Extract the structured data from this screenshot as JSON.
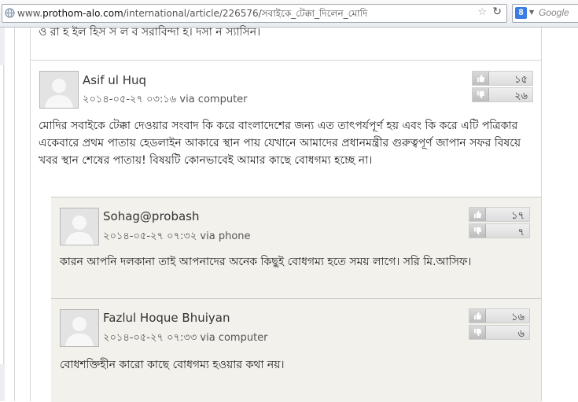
{
  "browser": {
    "url_prefix": "www.",
    "url_host": "prothom-alo.com",
    "url_path": "/international/article/226576/সবাইকে_টেক্কা_দিলেন_মোদি",
    "search_placeholder": "Google",
    "search_engine_letter": "8"
  },
  "page": {
    "cut_text": "ও রা হ ইল হিস স ল ব সরাবিন্দা হ। দসা ন স্যাসিন।"
  },
  "comments": [
    {
      "author": "Asif ul Huq",
      "date": "২০১৪-০৫-২৭ ০৩:১৬",
      "via": "via computer",
      "likes": "১৫",
      "dislikes": "২৬",
      "text": "মোদির সবাইকে টেক্কা দেওয়ার সংবাদ কি করে বাংলাদেশের জন্য এত তাৎপর্যপূর্ণ হয় এবং কি করে এটি পত্রিকার একেবারে প্রথম পাতায় হেডলাইন আকারে স্থান পায় যেখানে আমাদের প্রধানমন্ত্রীর গুরুত্বপূর্ণ জাপান সফর বিষয়ে খবর স্থান শেষের পাতায়! বিষয়টি কোনভাবেই আমার কাছে বোধগম্য হচ্ছে না।"
    },
    {
      "author": "Sohag@probash",
      "date": "২০১৪-০৫-২৭ ০৭:৩২",
      "via": "via phone",
      "likes": "১৭",
      "dislikes": "৭",
      "text": "কারন আপনি দলকানা তাই আপনাদের অনেক কিছুই বোধগম্য হতে সময় লাগে। সরি মি.আসিফ।"
    },
    {
      "author": "Fazlul Hoque Bhuiyan",
      "date": "২০১৪-০৫-২৭ ০৭:৩৩",
      "via": "via computer",
      "likes": "১৬",
      "dislikes": "৬",
      "text": "বোধশক্তিহীন কারো কাছে বোধগম্য হওয়ার কথা নয়।"
    }
  ]
}
